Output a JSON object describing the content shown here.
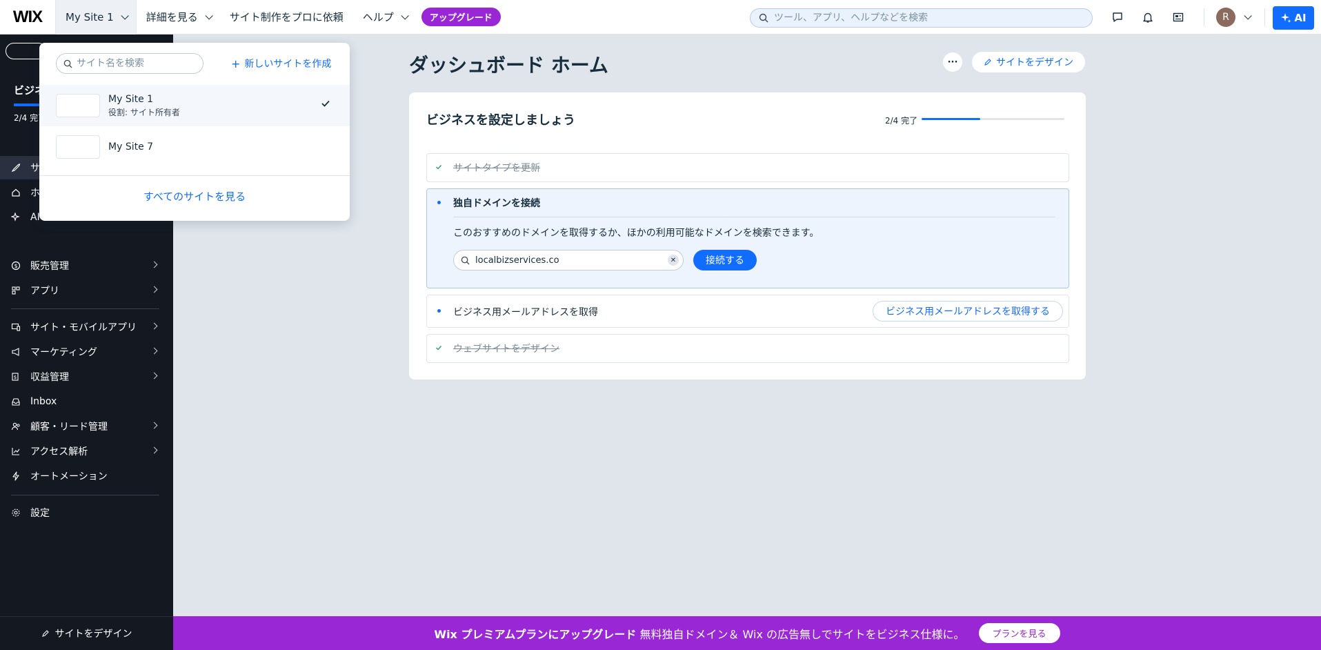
{
  "header": {
    "logo": "WIX",
    "site_name": "My Site 1",
    "nav": [
      {
        "label": "詳細を見る"
      },
      {
        "label": "サイト制作をプロに依頼"
      },
      {
        "label": "ヘルプ"
      }
    ],
    "upgrade": "アップグレード",
    "search_placeholder": "ツール、アプリ、ヘルプなどを検索",
    "avatar_initial": "R",
    "ai_label": "AI"
  },
  "sidebar": {
    "heading": "ビジネ",
    "complete": "2/4 完了",
    "items": [
      {
        "label": "サ"
      },
      {
        "label": "ホ"
      },
      {
        "label": "AI"
      },
      {
        "label": "販売管理"
      },
      {
        "label": "アプリ"
      },
      {
        "label": "サイト・モバイルアプリ"
      },
      {
        "label": "マーケティング"
      },
      {
        "label": "収益管理"
      },
      {
        "label": "Inbox"
      },
      {
        "label": "顧客・リード管理"
      },
      {
        "label": "アクセス解析"
      },
      {
        "label": "オートメーション"
      },
      {
        "label": "設定"
      }
    ],
    "bottom_label": "サイトをデザイン"
  },
  "dropdown": {
    "search_placeholder": "サイト名を検索",
    "new_site": "新しいサイトを作成",
    "sites": [
      {
        "name": "My Site 1",
        "role": "役割: サイト所有者"
      },
      {
        "name": "My Site 7"
      }
    ],
    "view_all": "すべてのサイトを見る"
  },
  "main": {
    "title": "ダッシュボード ホーム",
    "more": "···",
    "design_button": "サイトをデザイン",
    "card": {
      "title": "ビジネスを設定しましょう",
      "progress_label": "2/4 完了",
      "progress_fraction": 0.5,
      "tasks": [
        {
          "label": "サイトタイプを更新",
          "done": true
        },
        {
          "label": "独自ドメインを接続",
          "done": false,
          "description": "このおすすめのドメインを取得するか、ほかの利用可能なドメインを検索できます。",
          "domain_value": "localbizservices.co",
          "connect_label": "接続する"
        },
        {
          "label": "ビジネス用メールアドレスを取得",
          "done": false,
          "action_label": "ビジネス用メールアドレスを取得する"
        },
        {
          "label": "ウェブサイトをデザイン",
          "done": true
        }
      ]
    }
  },
  "banner": {
    "bold": "Wix プレミアムプランにアップグレード",
    "text": "無料独自ドメイン＆ Wix の広告無しでサイトをビジネス仕様に。",
    "button": "プランを見る"
  },
  "colors": {
    "accent": "#116dff",
    "upgrade_purple": "#9a27d5",
    "sidebar_bg": "#141821",
    "page_bg": "#dfe5eb"
  }
}
